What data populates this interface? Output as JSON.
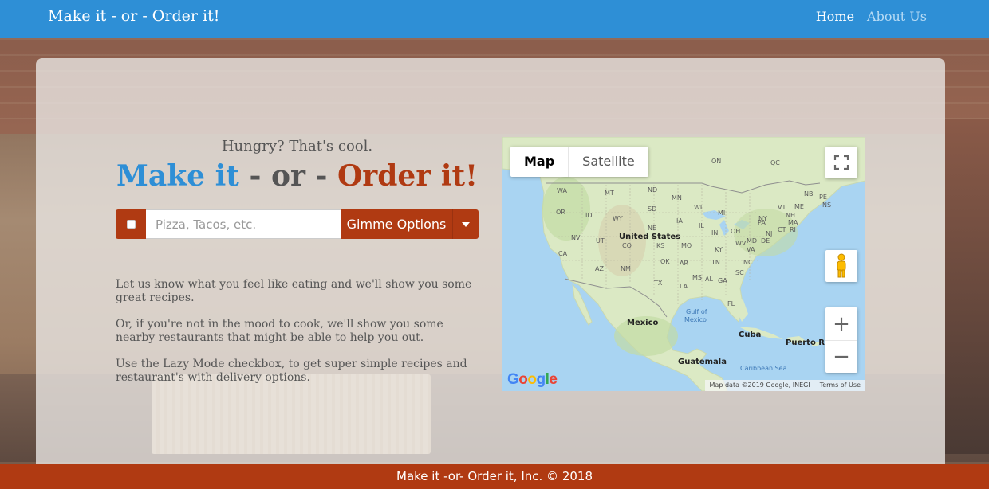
{
  "navbar": {
    "brand": "Make it - or - Order it!",
    "links": [
      {
        "label": "Home"
      },
      {
        "label": "About Us"
      }
    ]
  },
  "hero": {
    "tagline": "Hungry? That's cool.",
    "headline": {
      "part1": "Make it",
      "sep1": " - ",
      "part2": "or",
      "sep2": " - ",
      "part3": "Order it!"
    }
  },
  "search": {
    "placeholder": "Pizza, Tacos, etc.",
    "value": "",
    "button_label": "Gimme Options",
    "lazy_checked": false
  },
  "description": [
    "Let us know what you feel like eating and we'll show you some great recipes.",
    "Or, if you're not in the mood to cook, we'll show you some nearby restaurants that might be able to help you out.",
    "Use the Lazy Mode checkbox, to get super simple recipes and restaurant's with delivery options."
  ],
  "map": {
    "type_options": [
      "Map",
      "Satellite"
    ],
    "selected_type": "Map",
    "labels": {
      "on": "ON",
      "qc": "QC",
      "nb": "NB",
      "pe": "PE",
      "ns": "NS",
      "me": "ME",
      "wa": "WA",
      "mt": "MT",
      "nd": "ND",
      "mn": "MN",
      "wi": "WI",
      "mi": "MI",
      "or": "OR",
      "id": "ID",
      "wy": "WY",
      "sd": "SD",
      "ia": "IA",
      "il": "IL",
      "in": "IN",
      "oh": "OH",
      "pa": "PA",
      "ny": "NY",
      "vt": "VT",
      "nh": "NH",
      "ma": "MA",
      "ct": "CT",
      "ri": "RI",
      "nj": "NJ",
      "de": "DE",
      "md": "MD",
      "wv": "WV",
      "va": "VA",
      "ky": "KY",
      "tn": "TN",
      "nc": "NC",
      "sc": "SC",
      "ga": "GA",
      "al": "AL",
      "ms": "MS",
      "ar": "AR",
      "la": "LA",
      "fl": "FL",
      "mo": "MO",
      "ks": "KS",
      "ne": "NE",
      "co": "CO",
      "ut": "UT",
      "nv": "NV",
      "ca": "CA",
      "az": "AZ",
      "nm": "NM",
      "ok": "OK",
      "tx": "TX",
      "us": "United States",
      "mexico": "Mexico",
      "gulf1": "Gulf of",
      "gulf2": "Mexico",
      "cuba": "Cuba",
      "pr": "Puerto Rico",
      "guatemala": "Guatemala",
      "caribbean": "Caribbean Sea"
    },
    "google": "Google",
    "attribution": "Map data ©2019 Google, INEGI",
    "terms": "Terms of Use",
    "zoom_in": "+",
    "zoom_out": "−"
  },
  "footer": {
    "text": "Make it -or- Order it, Inc. © 2018"
  },
  "colors": {
    "nav_blue": "#2e8fd6",
    "brand_red": "#b03a12",
    "map_water": "#a9d4f2",
    "map_land": "#dbe9c4"
  }
}
